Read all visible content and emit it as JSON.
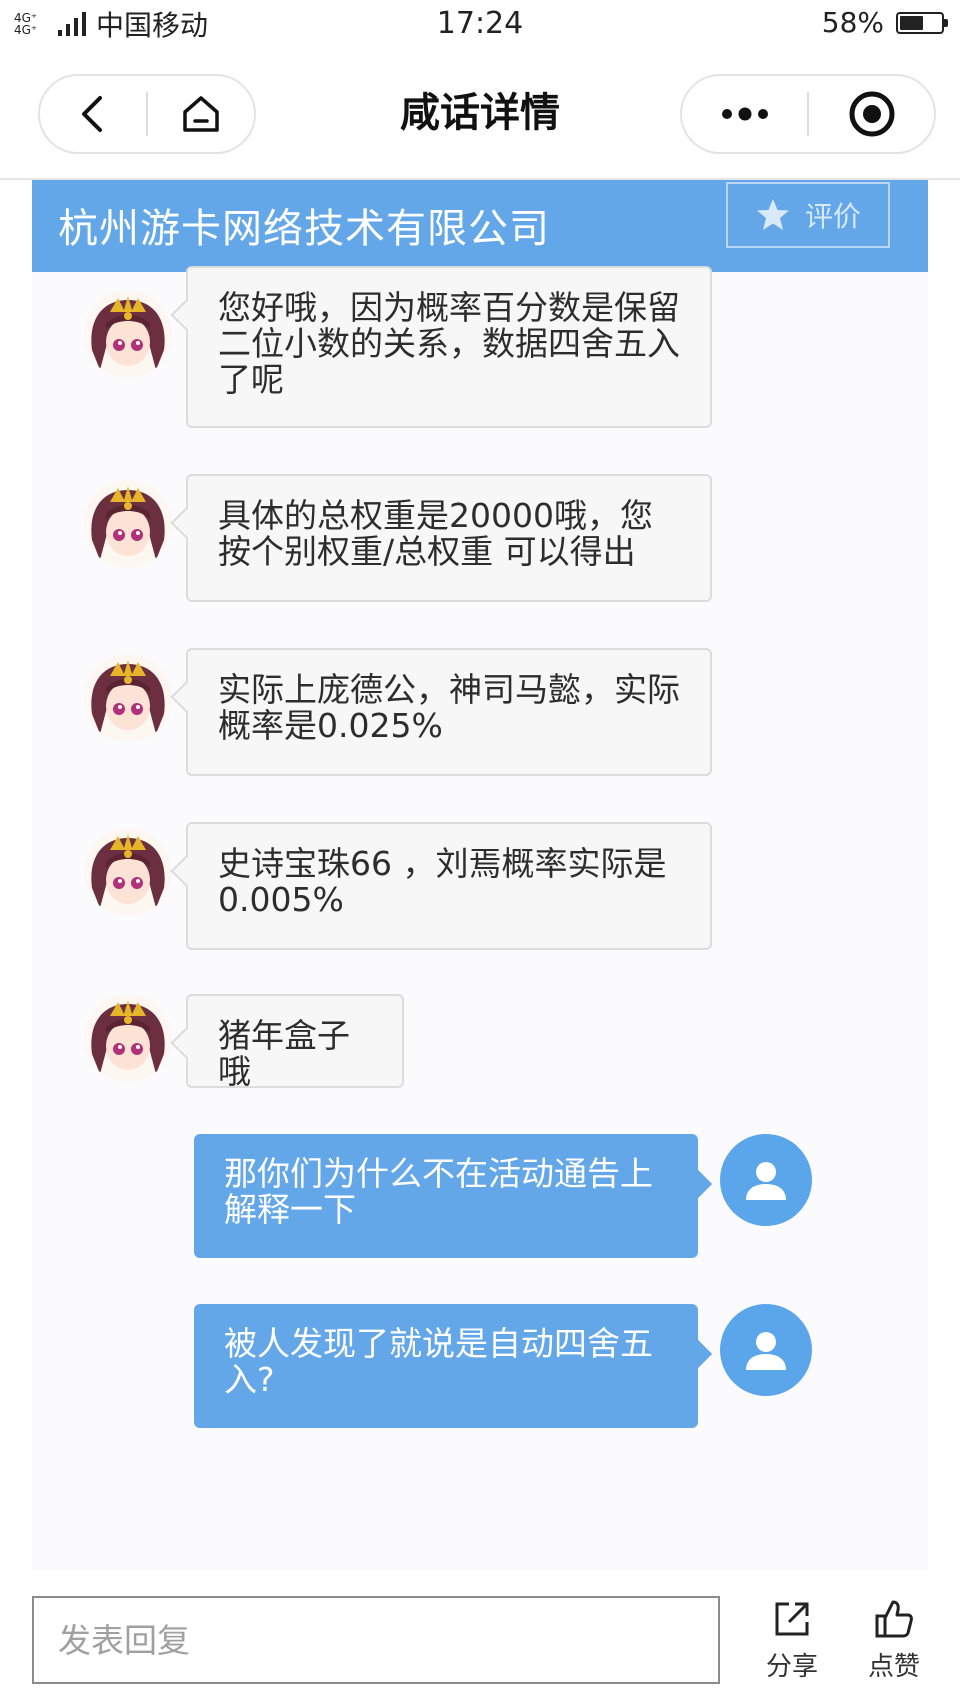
{
  "status_bar": {
    "network": "4G⁺ 4G⁺",
    "carrier": "中国移动",
    "time": "17:24",
    "battery_text": "58%",
    "battery_level": 0.58
  },
  "nav": {
    "title": "咸话详情",
    "back_icon": "chevron-left-icon",
    "home_icon": "home-icon",
    "more_icon": "more-dots-icon",
    "close_icon": "target-circle-icon"
  },
  "company": {
    "name": "杭州游卡网络技术有限公司",
    "rate_label": "评价",
    "rate_icon": "star-icon"
  },
  "messages": [
    {
      "side": "left",
      "text": "您好哦，因为概率百分数是保留二位小数的关系，数据四舍五入了呢"
    },
    {
      "side": "left",
      "text": "具体的总权重是20000哦，您按个别权重/总权重  可以得出"
    },
    {
      "side": "left",
      "text": "实际上庞德公，神司马懿，实际概率是0.025%"
    },
    {
      "side": "left",
      "text": "史诗宝珠66  ，刘焉概率实际是0.005%"
    },
    {
      "side": "left",
      "text": "猪年盒子哦"
    },
    {
      "side": "right",
      "text": "那你们为什么不在活动通告上解释一下"
    },
    {
      "side": "right",
      "text": "被人发现了就说是自动四舍五入?"
    }
  ],
  "colors": {
    "accent": "#64a7e9",
    "chat_bg": "#fbfafd",
    "bubble_left": "#f7f7f7"
  },
  "bottom": {
    "reply_placeholder": "发表回复",
    "share_label": "分享",
    "share_icon": "share-icon",
    "like_label": "点赞",
    "like_icon": "thumbs-up-icon"
  }
}
